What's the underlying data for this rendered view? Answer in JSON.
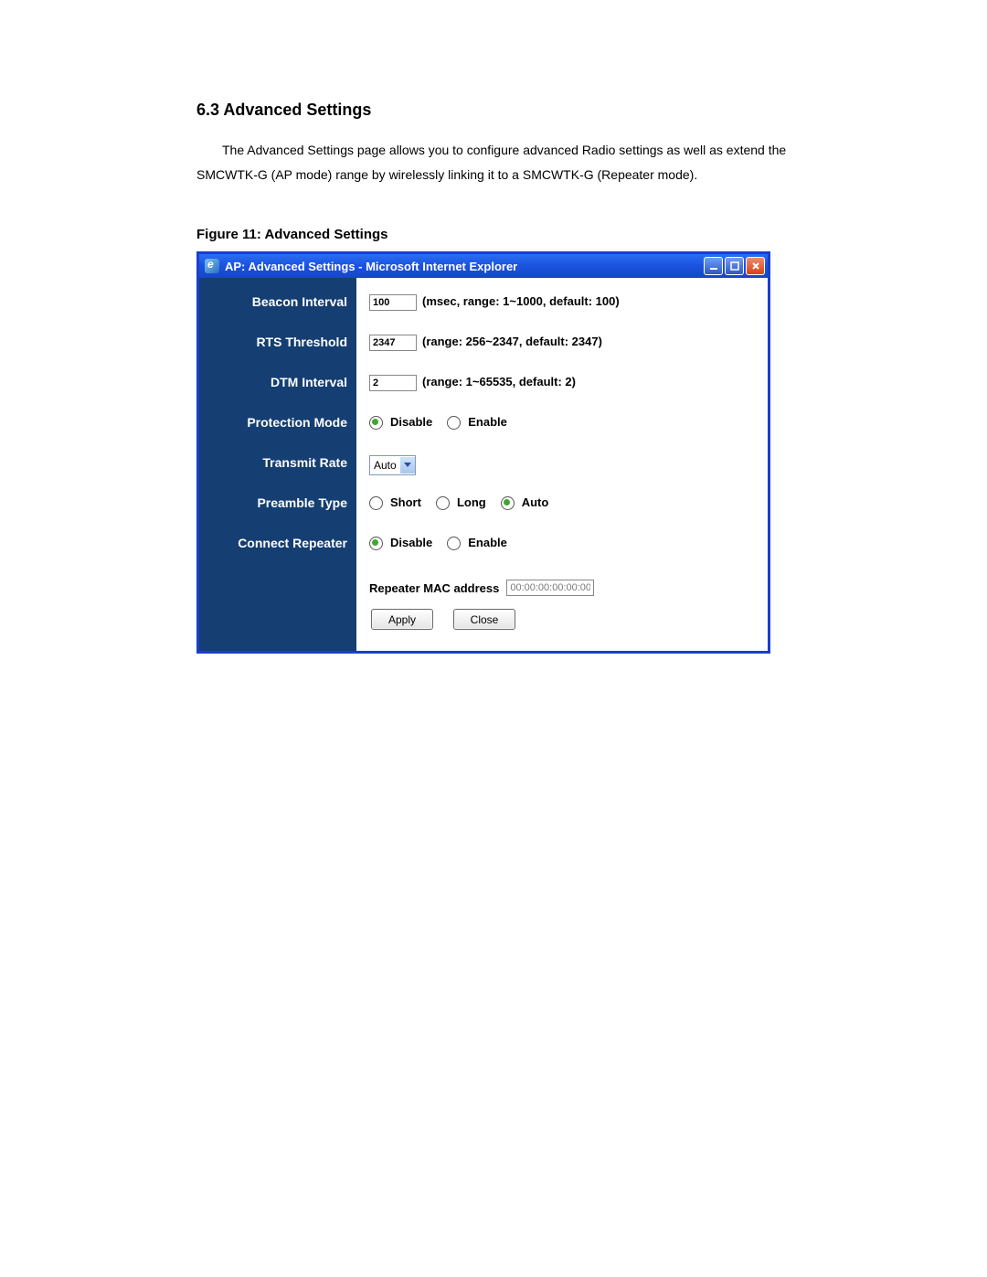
{
  "doc": {
    "heading": "6.3 Advanced Settings",
    "intro": "The Advanced Settings page allows you to configure advanced Radio settings as well as extend the SMCWTK-G (AP mode) range by wirelessly linking it to a SMCWTK-G (Repeater mode).",
    "figure_caption": "Figure 11: Advanced Settings"
  },
  "window": {
    "title": "AP: Advanced Settings - Microsoft Internet Explorer",
    "buttons": {
      "apply": "Apply",
      "close": "Close"
    }
  },
  "fields": {
    "beacon": {
      "label": "Beacon Interval",
      "value": "100",
      "hint": "(msec, range: 1~1000, default: 100)"
    },
    "rts": {
      "label": "RTS Threshold",
      "value": "2347",
      "hint": "(range: 256~2347, default: 2347)"
    },
    "dtm": {
      "label": "DTM Interval",
      "value": "2",
      "hint": "(range: 1~65535, default: 2)"
    },
    "protection": {
      "label": "Protection Mode",
      "options": {
        "disable": "Disable",
        "enable": "Enable"
      },
      "selected": "disable"
    },
    "txrate": {
      "label": "Transmit Rate",
      "value": "Auto"
    },
    "preamble": {
      "label": "Preamble Type",
      "options": {
        "short": "Short",
        "long": "Long",
        "auto": "Auto"
      },
      "selected": "auto"
    },
    "repeater": {
      "label": "Connect Repeater",
      "options": {
        "disable": "Disable",
        "enable": "Enable"
      },
      "selected": "disable",
      "mac_label": "Repeater MAC address",
      "mac_value": "00:00:00:00:00:00"
    }
  }
}
